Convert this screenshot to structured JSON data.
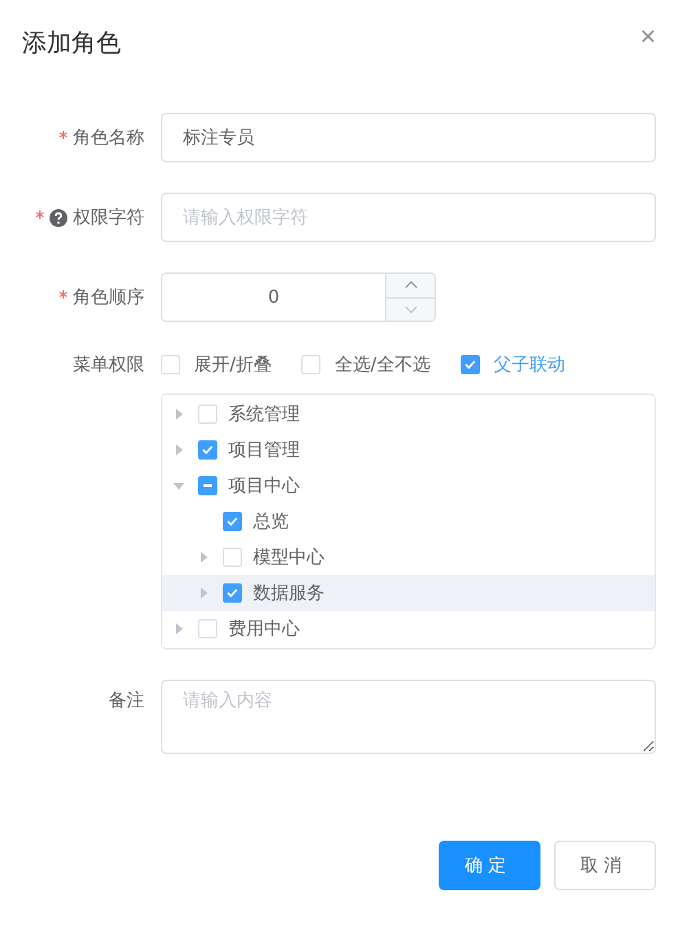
{
  "dialog": {
    "title": "添加角色",
    "close": "×"
  },
  "fields": [
    {
      "kind": "text",
      "label": "角色名称",
      "required": true,
      "help": false,
      "value": "标注专员"
    },
    {
      "kind": "text",
      "label": "权限字符",
      "required": true,
      "help": true,
      "placeholder": "请输入权限字符"
    },
    {
      "kind": "number",
      "label": "角色顺序",
      "required": true,
      "help": false,
      "value": "0"
    }
  ],
  "menu_permissions": {
    "label": "菜单权限",
    "options": [
      {
        "label": "展开/折叠",
        "checked": false
      },
      {
        "label": "全选/全不选",
        "checked": false
      },
      {
        "label": "父子联动",
        "checked": true
      }
    ],
    "tree": [
      {
        "label": "系统管理",
        "kind": "branch",
        "expanded": false,
        "checked": false,
        "selected": false
      },
      {
        "label": "项目管理",
        "kind": "branch",
        "expanded": false,
        "checked": true,
        "selected": false
      },
      {
        "label": "项目中心",
        "kind": "branch",
        "expanded": true,
        "checked": false,
        "indeterminate": true,
        "selected": false,
        "children": [
          {
            "label": "总览",
            "kind": "leaf",
            "checked": true,
            "selected": false
          },
          {
            "label": "模型中心",
            "kind": "branch",
            "expanded": false,
            "checked": false,
            "selected": false
          },
          {
            "label": "数据服务",
            "kind": "branch",
            "expanded": false,
            "checked": true,
            "selected": true
          }
        ]
      },
      {
        "label": "费用中心",
        "kind": "branch",
        "expanded": false,
        "checked": false,
        "selected": false
      }
    ]
  },
  "remark": {
    "label": "备注",
    "placeholder": "请输入内容"
  },
  "buttons": [
    {
      "label": "确定",
      "kind": "primary"
    },
    {
      "label": "取消",
      "kind": "default"
    }
  ]
}
